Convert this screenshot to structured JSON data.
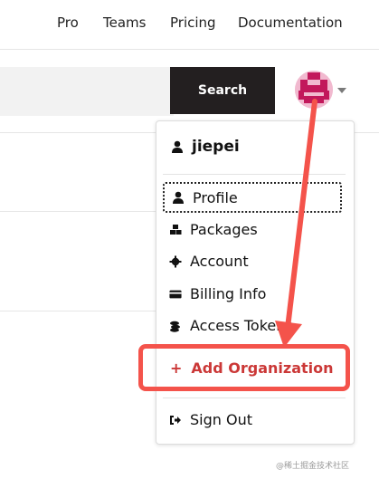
{
  "nav": {
    "links": [
      "Pro",
      "Teams",
      "Pricing",
      "Documentation"
    ]
  },
  "search": {
    "button_label": "Search",
    "placeholder": ""
  },
  "user_menu": {
    "username": "jiepei",
    "items": [
      {
        "label": "Profile",
        "icon": "user-icon"
      },
      {
        "label": "Packages",
        "icon": "packages-icon"
      },
      {
        "label": "Account",
        "icon": "gear-icon"
      },
      {
        "label": "Billing Info",
        "icon": "credit-card-icon"
      },
      {
        "label": "Access Tokens",
        "icon": "coins-icon"
      }
    ],
    "add_org_label": "Add Organization",
    "add_org_symbol": "+",
    "sign_out_label": "Sign Out"
  },
  "colors": {
    "accent": "#cb3837",
    "annotation": "#f4534b",
    "search_button": "#231f20"
  },
  "watermark": "@稀土掘金技术社区"
}
